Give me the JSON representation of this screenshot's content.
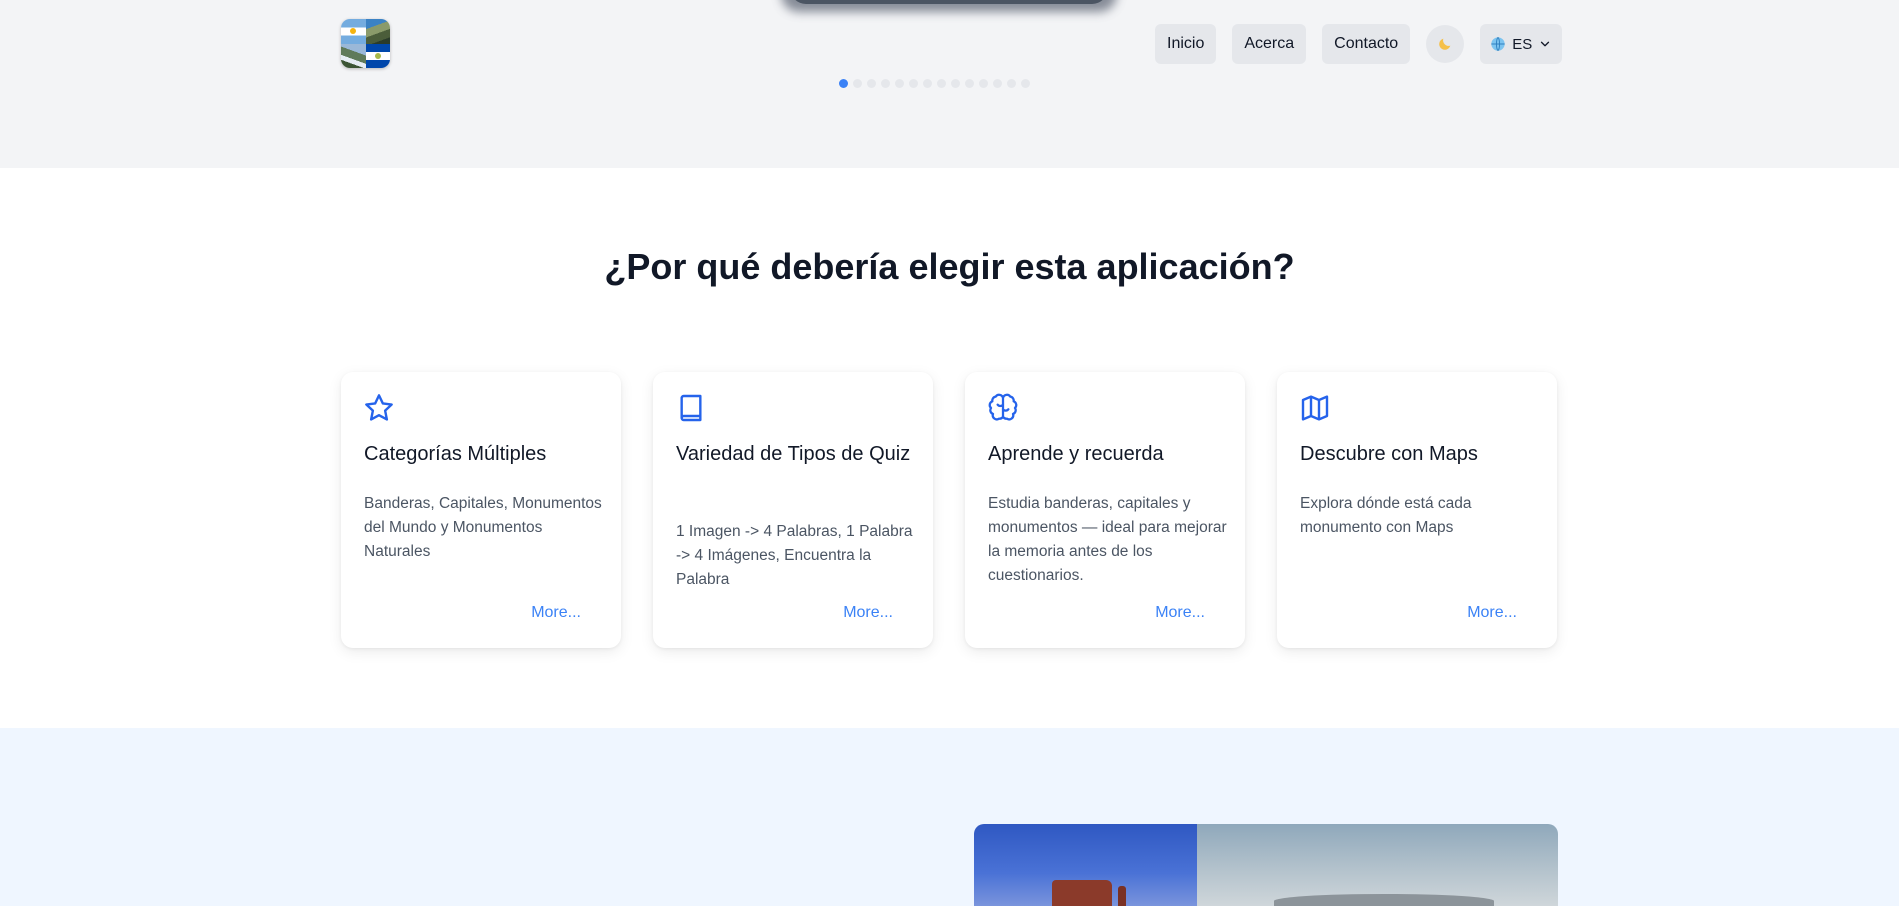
{
  "header": {
    "nav": [
      {
        "label": "Inicio"
      },
      {
        "label": "Acerca"
      },
      {
        "label": "Contacto"
      }
    ],
    "theme_icon": "moon-icon",
    "language": {
      "label": "ES",
      "icon": "globe-icon"
    }
  },
  "carousel": {
    "slide_count": 14,
    "active_index": 0
  },
  "features": {
    "title": "¿Por qué debería elegir esta aplicación?",
    "cards": [
      {
        "icon": "star-icon",
        "title": "Categorías Múltiples",
        "description": "Banderas, Capitales, Monumentos del Mundo y Monumentos Naturales",
        "link": "More..."
      },
      {
        "icon": "book-icon",
        "title": "Variedad de Tipos de Quiz",
        "description": "1 Imagen -> 4 Palabras, 1 Palabra -> 4 Imágenes, Encuentra la Palabra",
        "link": "More..."
      },
      {
        "icon": "brain-icon",
        "title": "Aprende y recuerda",
        "description": "Estudia banderas, capitales y monumentos — ideal para mejorar la memoria antes de los cuestionarios.",
        "link": "More..."
      },
      {
        "icon": "map-icon",
        "title": "Descubre con Maps",
        "description": "Explora dónde está cada monumento con Maps",
        "link": "More..."
      }
    ]
  },
  "colors": {
    "accent": "#3b82f6",
    "hero_background": "#f3f4f6",
    "lower_background": "#eff6ff"
  }
}
